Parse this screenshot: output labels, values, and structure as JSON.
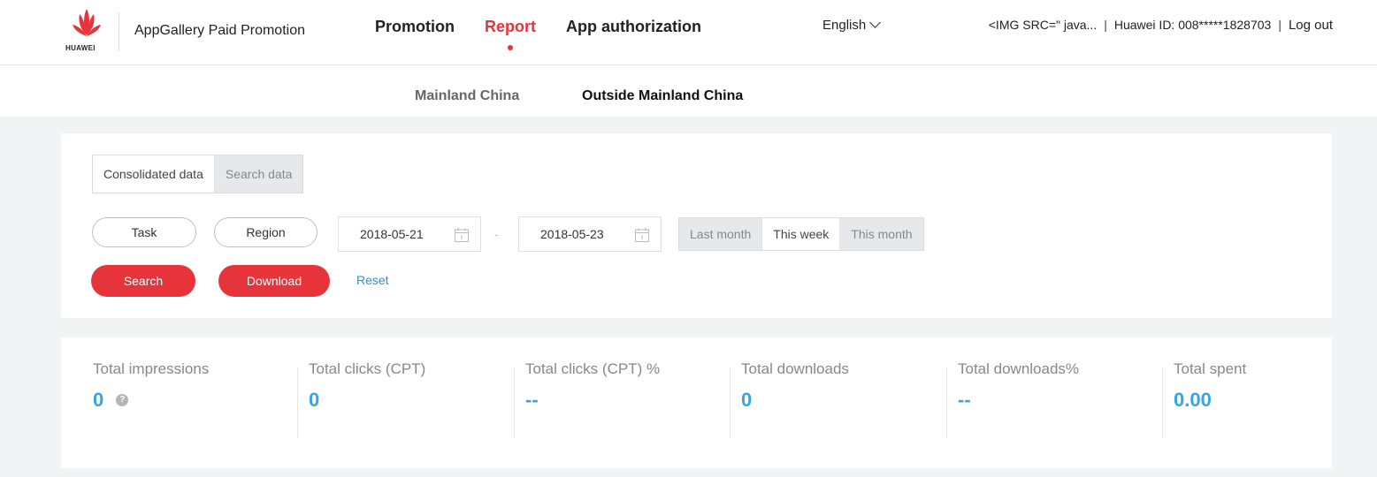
{
  "header": {
    "logo_text": "HUAWEI",
    "app_title": "AppGallery Paid Promotion",
    "nav": [
      "Promotion",
      "Report",
      "App authorization"
    ],
    "active_nav": "Report",
    "language": "English",
    "user_text": "<IMG SRC=\" java...",
    "huawei_id": "Huawei ID: 008*****1828703",
    "separator": "|",
    "logout": "Log out"
  },
  "region_tabs": {
    "items": [
      "Mainland China",
      "Outside Mainland China"
    ],
    "active": "Outside Mainland China"
  },
  "filters": {
    "data_tabs": [
      "Consolidated data",
      "Search data"
    ],
    "task_label": "Task",
    "region_label": "Region",
    "start_date": "2018-05-21",
    "end_date": "2018-05-23",
    "date_separator": "-",
    "range_tabs": [
      "Last month",
      "This week",
      "This month"
    ],
    "search_label": "Search",
    "download_label": "Download",
    "reset_label": "Reset"
  },
  "stats": [
    {
      "label": "Total impressions",
      "value": "0"
    },
    {
      "label": "Total clicks (CPT)",
      "value": "0"
    },
    {
      "label": "Total clicks (CPT) %",
      "value": "--"
    },
    {
      "label": "Total downloads",
      "value": "0"
    },
    {
      "label": "Total downloads%",
      "value": "--"
    },
    {
      "label": "Total spent",
      "value": "0.00"
    }
  ],
  "colors": {
    "brand_red": "#e7343b",
    "stat_blue": "#36a5e0",
    "link_blue": "#2f8fd1"
  },
  "icons": {
    "logo": "huawei-logo-icon",
    "chevron": "chevron-down-icon",
    "calendar": "calendar-icon",
    "help": "help-icon"
  }
}
